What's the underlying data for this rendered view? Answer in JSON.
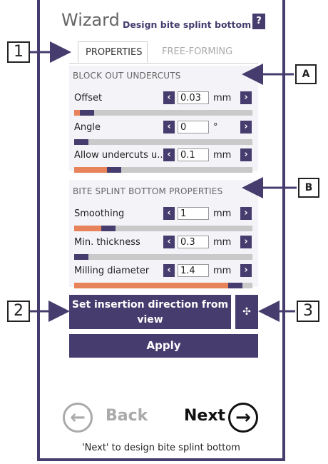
{
  "header": {
    "title": "Wizard",
    "subtitle": "Design bite splint bottom",
    "help_label": "?"
  },
  "tabs": [
    {
      "label": "PROPERTIES",
      "active": true
    },
    {
      "label": "FREE-FORMING",
      "active": false
    }
  ],
  "sections": {
    "block_out": {
      "heading": "BLOCK OUT UNDERCUTS",
      "items": [
        {
          "label": "Offset",
          "value": "0.03",
          "unit": "mm",
          "slider_level": 0.1
        },
        {
          "label": "Angle",
          "value": "0",
          "unit": "°",
          "slider_level": 0.06
        },
        {
          "label": "Allow undercuts u...",
          "value": "0.1",
          "unit": "mm",
          "slider_level": 0.22
        }
      ]
    },
    "bite_splint": {
      "heading": "BITE SPLINT BOTTOM PROPERTIES",
      "items": [
        {
          "label": "Smoothing",
          "value": "1",
          "unit": "mm",
          "slider_level": 0.2
        },
        {
          "label": "Min. thickness",
          "value": "0.3",
          "unit": "mm",
          "slider_level": 0.06
        },
        {
          "label": "Milling diameter",
          "value": "1.4",
          "unit": "mm",
          "slider_level": 0.95
        }
      ]
    }
  },
  "buttons": {
    "insertion_line1": "Set insertion direction from",
    "insertion_line2": "view",
    "crosshair_icon": "✣",
    "apply": "Apply"
  },
  "nav": {
    "back": "Back",
    "next": "Next",
    "back_arrow": "←",
    "next_arrow": "→"
  },
  "footer": {
    "hint": "'Next' to design bite splint bottom"
  },
  "callouts": {
    "c1": "1",
    "c2": "2",
    "c3": "3",
    "cA": "A",
    "cB": "B"
  },
  "colors": {
    "accent": "#463c6e",
    "slider_fill": "#e8825a",
    "slider_track": "#c9c9c9"
  }
}
